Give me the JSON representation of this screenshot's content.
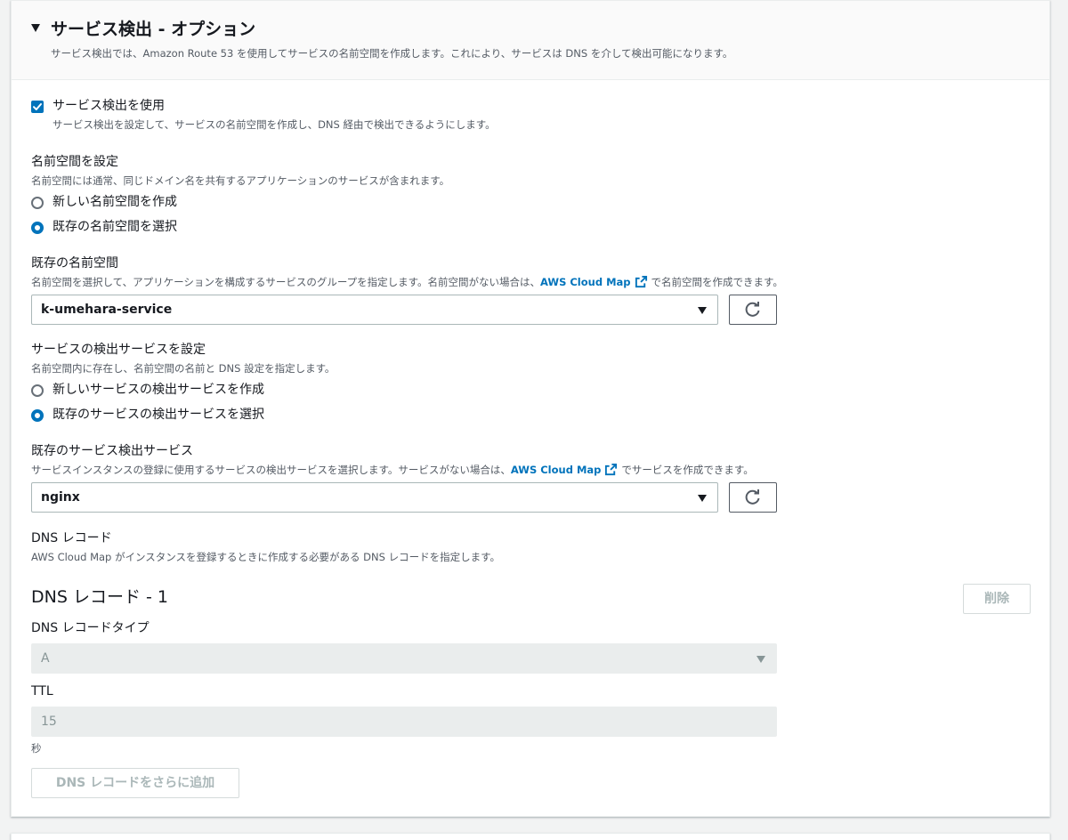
{
  "section": {
    "title": "サービス検出 - オプション",
    "description": "サービス検出では、Amazon Route 53 を使用してサービスの名前空間を作成します。これにより、サービスは DNS を介して検出可能になります。"
  },
  "use_service_discovery": {
    "label": "サービス検出を使用",
    "description": "サービス検出を設定して、サービスの名前空間を作成し、DNS 経由で検出できるようにします。",
    "checked": true
  },
  "namespace_config": {
    "label": "名前空間を設定",
    "description": "名前空間には通常、同じドメイン名を共有するアプリケーションのサービスが含まれます。",
    "options": [
      {
        "label": "新しい名前空間を作成",
        "selected": false
      },
      {
        "label": "既存の名前空間を選択",
        "selected": true
      }
    ]
  },
  "existing_namespace": {
    "label": "既存の名前空間",
    "description_prefix": "名前空間を選択して、アプリケーションを構成するサービスのグループを指定します。名前空間がない場合は、",
    "link": "AWS Cloud Map",
    "description_suffix": "で名前空間を作成できます。",
    "value": "k-umehara-service"
  },
  "discovery_service_config": {
    "label": "サービスの検出サービスを設定",
    "description": "名前空間内に存在し、名前空間の名前と DNS 設定を指定します。",
    "options": [
      {
        "label": "新しいサービスの検出サービスを作成",
        "selected": false
      },
      {
        "label": "既存のサービスの検出サービスを選択",
        "selected": true
      }
    ]
  },
  "existing_discovery_service": {
    "label": "既存のサービス検出サービス",
    "description_prefix": "サービスインスタンスの登録に使用するサービスの検出サービスを選択します。サービスがない場合は、",
    "link": "AWS Cloud Map",
    "description_suffix": "でサービスを作成できます。",
    "value": "nginx"
  },
  "dns_records": {
    "label": "DNS レコード",
    "description": "AWS Cloud Map がインスタンスを登録するときに作成する必要がある DNS レコードを指定します。",
    "record_title": "DNS レコード - 1",
    "delete_label": "削除",
    "type_label": "DNS レコードタイプ",
    "type_value": "A",
    "ttl_label": "TTL",
    "ttl_value": "15",
    "ttl_unit": "秒",
    "add_label": "DNS レコードをさらに追加"
  },
  "colors": {
    "accent": "#0073bb",
    "link": "#0073bb",
    "disabled_bg": "#eaeded",
    "disabled_text": "#879596"
  }
}
